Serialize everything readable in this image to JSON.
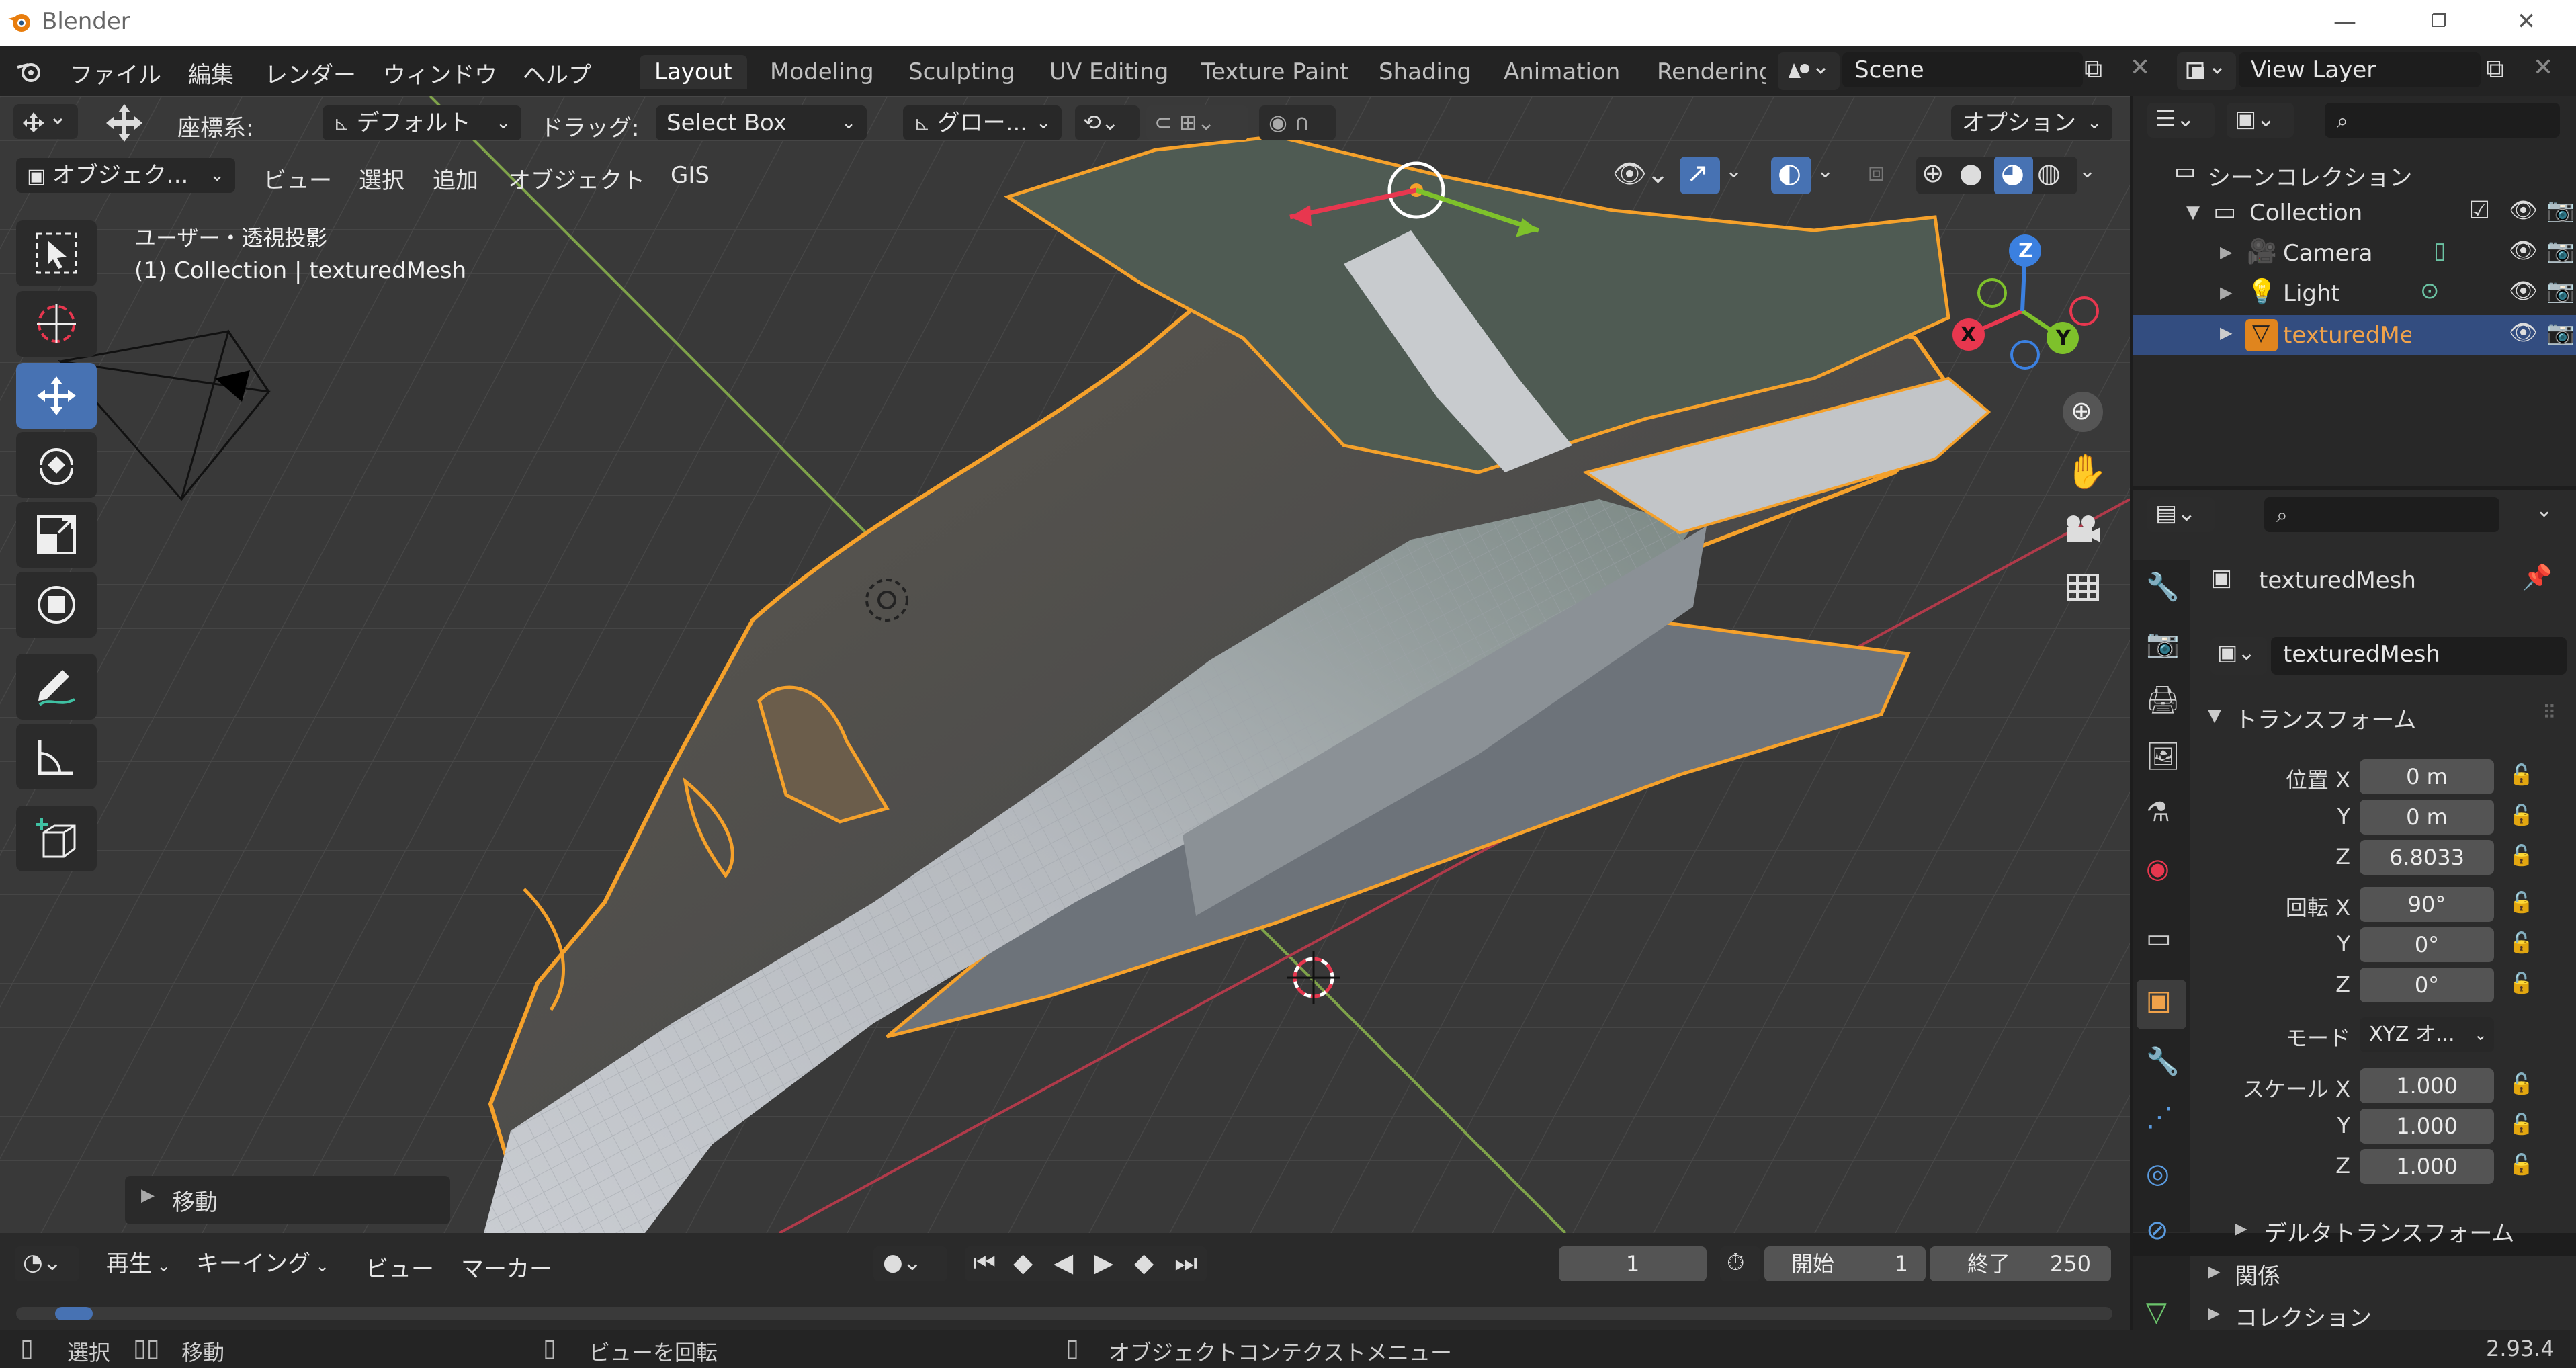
{
  "window": {
    "title": "Blender",
    "version": "2.93.4"
  },
  "menu": {
    "items": [
      "ファイル",
      "編集",
      "レンダー",
      "ウィンドウ",
      "ヘルプ"
    ]
  },
  "workspaces": [
    "Layout",
    "Modeling",
    "Sculpting",
    "UV Editing",
    "Texture Paint",
    "Shading",
    "Animation",
    "Rendering"
  ],
  "active_workspace": "Layout",
  "scene": {
    "name": "Scene"
  },
  "view_layer": {
    "name": "View Layer"
  },
  "viewport_header": {
    "coord_label": "座標系:",
    "coord_value": "デフォルト",
    "drag_label": "ドラッグ:",
    "drag_value": "Select Box",
    "transform_orient": "グロー...",
    "options": "オプション"
  },
  "viewport_menu": {
    "mode": "オブジェク...",
    "items": [
      "ビュー",
      "選択",
      "追加",
      "オブジェクト",
      "GIS"
    ]
  },
  "viewport_info": {
    "line1": "ユーザー・透視投影",
    "line2": "(1) Collection | texturedMesh"
  },
  "gizmo": {
    "x": "X",
    "y": "Y",
    "z": "Z"
  },
  "operator_panel": {
    "label": "移動"
  },
  "outliner": {
    "root": "シーンコレクション",
    "collection": "Collection",
    "items": [
      "Camera",
      "Light",
      "texturedMesh"
    ]
  },
  "properties": {
    "object_name": "texturedMesh",
    "datablock": "texturedMesh",
    "transform_title": "トランスフォーム",
    "location_label": "位置 X",
    "location": [
      "0 m",
      "0 m",
      "6.8033"
    ],
    "rotation_label": "回転 X",
    "rotation": [
      "90°",
      "0°",
      "0°"
    ],
    "mode_label": "モード",
    "mode_value": "XYZ オ...",
    "scale_label": "スケール X",
    "scale": [
      "1.000",
      "1.000",
      "1.000"
    ],
    "axis_y": "Y",
    "axis_z": "Z",
    "delta": "デルタトランスフォーム",
    "relations": "関係",
    "collection": "コレクション"
  },
  "timeline": {
    "playback": "再生",
    "keying": "キーイング",
    "view": "ビュー",
    "marker": "マーカー",
    "current_frame": "1",
    "start_label": "開始",
    "start": "1",
    "end_label": "終了",
    "end": "250"
  },
  "status": {
    "select": "選択",
    "move": "移動",
    "rotate_view": "ビューを回転",
    "context_menu": "オブジェクトコンテクストメニュー"
  },
  "colors": {
    "accent": "#4772b3",
    "selection": "#f5a12b",
    "x_axis": "#e8374f",
    "y_axis": "#7ec12b",
    "z_axis": "#3b80e0"
  }
}
